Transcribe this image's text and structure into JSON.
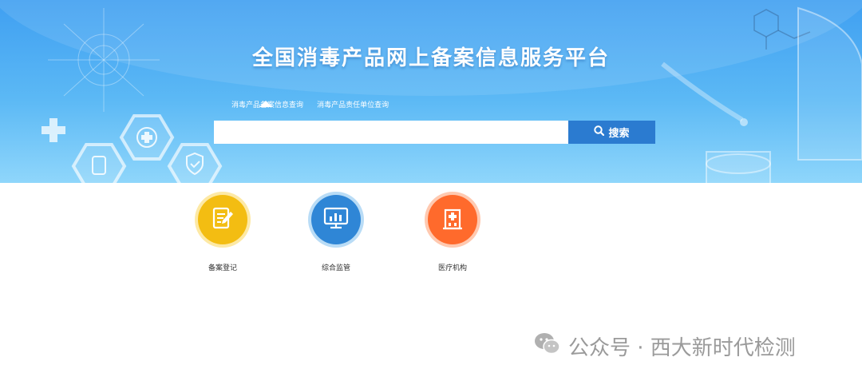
{
  "header": {
    "title": "全国消毒产品网上备案信息服务平台"
  },
  "search": {
    "tabs": [
      {
        "label": "消毒产品备案信息查询",
        "active": true
      },
      {
        "label": "消毒产品责任单位查询",
        "active": false
      }
    ],
    "placeholder": "",
    "button_label": "搜索",
    "button_icon": "search-icon"
  },
  "nav": [
    {
      "label": "备案登记",
      "icon": "notebook-pen-icon",
      "color": "#f3bd12"
    },
    {
      "label": "综合监管",
      "icon": "monitor-chart-icon",
      "color": "#2f86d6"
    },
    {
      "label": "医疗机构",
      "icon": "hospital-icon",
      "color": "#ff6a2c"
    }
  ],
  "watermark": {
    "icon": "wechat-icon",
    "text": "公众号 · 西大新时代检测"
  },
  "colors": {
    "banner_top": "#3f9ff1",
    "banner_bottom": "#8fd6fb",
    "search_button": "#2b7bd0",
    "text": "#333333"
  }
}
